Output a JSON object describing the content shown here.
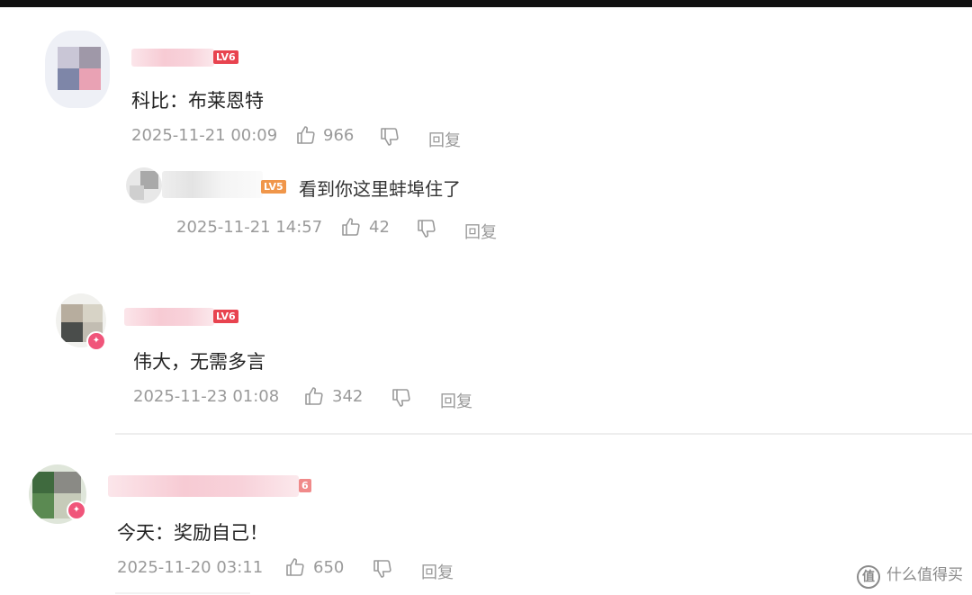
{
  "comments": [
    {
      "level": "LV6",
      "text": "科比：布莱恩特",
      "time": "2025-11-21 00:09",
      "likes": "966",
      "reply_label": "回复",
      "replies": [
        {
          "level": "LV5",
          "text": "看到你这里蚌埠住了",
          "time": "2025-11-21 14:57",
          "likes": "42",
          "reply_label": "回复"
        }
      ]
    },
    {
      "level": "LV6",
      "text": "伟大，无需多言",
      "time": "2025-11-23 01:08",
      "likes": "342",
      "reply_label": "回复"
    },
    {
      "level": "6",
      "text": "今天：奖励自己！",
      "time": "2025-11-20 03:11",
      "likes": "650",
      "reply_label": "回复"
    }
  ],
  "watermark": {
    "text": "什么值得买",
    "icon": "zhi-logo-icon"
  },
  "colors": {
    "level_badge": "#e8434f",
    "level_badge_reply": "#f0964a",
    "meta_gray": "#9a9a9a",
    "vip_badge": "#f0557a"
  }
}
